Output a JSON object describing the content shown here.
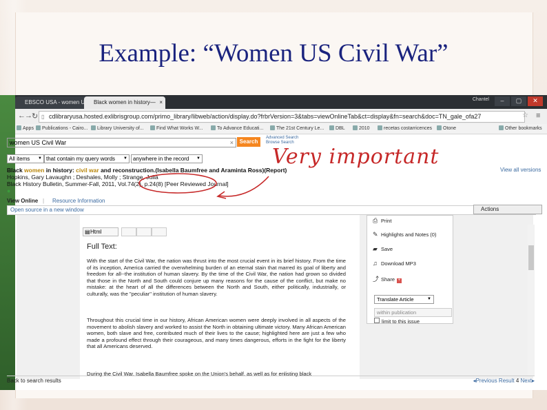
{
  "slide": {
    "title": "Example: “Women US Civil War”"
  },
  "annotation": {
    "text": "Very important"
  },
  "browser": {
    "tabs": [
      "EBSCO USA - women US",
      "Black women in history—"
    ],
    "user": "Chantel",
    "buttons": {
      "minimize": "–",
      "maximize": "▢",
      "close": "✕"
    },
    "url": "cdlibraryusa.hosted.exlibrisgroup.com/primo_library/libweb/action/display.do?frbrVersion=3&tabs=viewOnlineTab&ct=display&fn=search&doc=TN_gale_ofa27",
    "bookmarks": [
      "Apps",
      "Publications - Cairo...",
      "Library University of...",
      "Find What Works W...",
      "To Advance Educati...",
      "The 21st Century Le...",
      "DBL",
      "2010",
      "recetas costarricences",
      "Otone",
      "Other bookmarks"
    ]
  },
  "search": {
    "query": "women US Civil War",
    "button": "Search",
    "advanced": "Advanced Search",
    "browse": "Browse Search",
    "scope": "All items",
    "match": "that contain my query words",
    "field": "anywhere in the record"
  },
  "result": {
    "title_pre": "Black ",
    "title_hl1": "women",
    "title_mid1": " in history: ",
    "title_hl2": "civil war",
    "title_mid2": " and reconstruction.(Isabella Baumfree and Araminta Ross)(Report)",
    "authors": "Hopkins, Gary Lavaughn ; Deshales, Molly ; Strange, Julia",
    "source": "Black History Bulletin, Summer-Fall, 2011, Vol.74(2), p.24(8)",
    "peer": "[Peer Reviewed Journal]",
    "view_all": "View all versions"
  },
  "tabs": {
    "view_online": "View Online",
    "resource_info": "Resource Information",
    "open_new": "Open source in a new window",
    "actions": "Actions"
  },
  "document": {
    "html_button": "Html",
    "heading": "Full Text:",
    "para1": "With the start of the Civil War, the nation was thrust into the most crucial event in its brief history. From the time of its inception, America carried the overwhelming burden of an eternal stain that marred its goal of liberty and freedom for all--the institution of human slavery. By the time of the Civil War, the nation had grown so divided that those in the North and South could conjure up many reasons for the cause of the conflict, but make no mistake: at the heart of all the differences between the North and South, either politically, industrially, or culturally, was the \"peculiar\" institution of human slavery.",
    "para2": "Throughout this crucial time in our history, African American women were deeply involved in all aspects of the movement to abolish slavery and worked to assist the North in obtaining ultimate victory. Many African American women, both slave and free, contributed much of their lives to the cause; highlighted here are just a few who made a profound effect through their courageous, and many times dangerous, efforts in the fight for the liberty that all Americans deserved.",
    "para3": "During the Civil War, Isabella Baumfree spoke on the Union's behalf, as well as for enlisting black"
  },
  "tools": {
    "print": "Print",
    "highlights": "Highlights and Notes (0)",
    "save": "Save",
    "download": "Download MP3",
    "share": "Share",
    "translate": "Translate Article",
    "within": "within publication",
    "limit": "limit to this issue"
  },
  "footer": {
    "back": "Back to search results",
    "prev": "◂Previous Result",
    "page": "4",
    "next": "Next▸"
  }
}
